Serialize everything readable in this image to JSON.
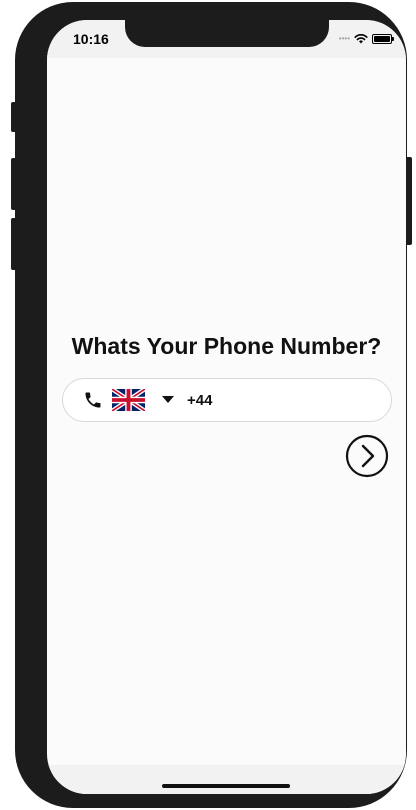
{
  "status_bar": {
    "time": "10:16",
    "signal_dots": "••••",
    "icons": [
      "wifi-icon",
      "battery-icon"
    ]
  },
  "main": {
    "title": "Whats Your Phone Number?",
    "phone_input": {
      "icon": "phone-icon",
      "country_flag": "uk-flag-icon",
      "dropdown_icon": "caret-down-icon",
      "dial_code": "+44",
      "value": ""
    },
    "next_button_icon": "chevron-right-circle-icon"
  },
  "colors": {
    "screen_background": "#fbfbfb",
    "frame": "#1c1c1c",
    "input_border": "#d8d8d8",
    "text": "#111111"
  }
}
